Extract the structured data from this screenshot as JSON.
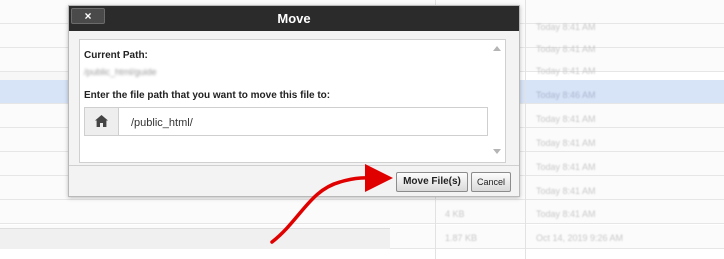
{
  "dialog": {
    "title": "Move",
    "close_label": "×",
    "current_path_label": "Current Path:",
    "current_path_value": "/public_html/guide",
    "prompt_label": "Enter the file path that you want to move this file to:",
    "destination_value": "/public_html/",
    "move_button_label": "Move File(s)",
    "cancel_button_label": "Cancel"
  },
  "icons": {
    "home": "home-icon",
    "close": "close-icon",
    "annotation": "red-arrow"
  },
  "background": {
    "rows": [
      {
        "size": "",
        "date": "Today 8:41 AM"
      },
      {
        "size": "",
        "date": "Today 8:41 AM"
      },
      {
        "size": "",
        "date": "Today 8:41 AM"
      },
      {
        "size": "",
        "date": "Today 8:46 AM"
      },
      {
        "size": "",
        "date": "Today 8:41 AM"
      },
      {
        "size": "",
        "date": "Today 8:41 AM"
      },
      {
        "size": "",
        "date": "Today 8:41 AM"
      },
      {
        "size": "",
        "date": "Today 8:41 AM"
      },
      {
        "size": "4 KB",
        "date": "Today 8:41 AM"
      },
      {
        "size": "1.87 KB",
        "date": "Oct 14, 2019 9:26 AM"
      }
    ]
  },
  "colors": {
    "titlebar": "#2b2b2b",
    "annotation": "#e00000",
    "selected_row": "#d7e3f7"
  }
}
